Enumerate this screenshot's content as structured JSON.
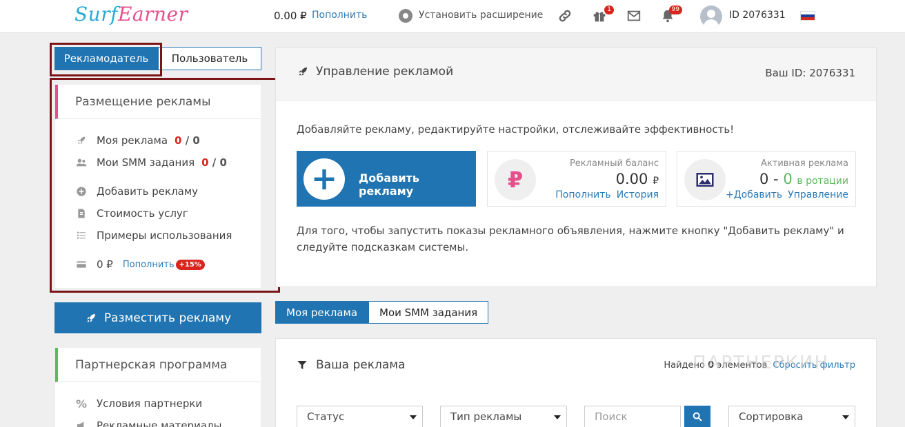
{
  "header": {
    "logo_part1": "Surf",
    "logo_part2": "Earner",
    "balance": "0.00 ₽",
    "topup_label": "Пополнить",
    "extension_label": "Установить расширение",
    "gift_badge": "1",
    "bell_badge": "99",
    "user_id": "ID 2076331"
  },
  "role_tabs": {
    "advertiser": "Рекламодатель",
    "user": "Пользователь"
  },
  "ad_panel": {
    "title": "Размещение рекламы",
    "my_ads_label": "Моя реклама",
    "my_ads_active": "0",
    "my_ads_total": "/ 0",
    "smm_label": "Мои SMM задания",
    "smm_active": "0",
    "smm_total": "/ 0",
    "add_ad_label": "Добавить рекламу",
    "price_label": "Стоимость услуг",
    "examples_label": "Примеры использования",
    "balance": "0 ₽",
    "topup_label": "Пополнить",
    "bonus": "+15%"
  },
  "place_button": "Разместить рекламу",
  "partner_panel": {
    "title": "Партнерская программа",
    "terms_label": "Условия партнерки",
    "materials_label": "Рекламные материалы"
  },
  "main": {
    "title": "Управление рекламой",
    "your_id": "Ваш ID: 2076331",
    "description": "Добавляйте рекламу, редактируйте настройки, отслеживайте эффективность!",
    "add_button": "Добавить рекламу",
    "balance_card": {
      "title": "Рекламный баланс",
      "value": "0.00",
      "currency": "₽",
      "link1": "Пополнить",
      "link2": "История"
    },
    "active_card": {
      "title": "Активная реклама",
      "value_left": "0 -",
      "value_right": "0",
      "rotation": "в ротации",
      "link1": "+Добавить",
      "link2": "Управление"
    },
    "hint": "Для того, чтобы запустить показы рекламного объявления, нажмите кнопку \"Добавить рекламу\" и следуйте подсказкам системы."
  },
  "bottom_tabs": {
    "my_ads": "Моя реклама",
    "smm": "Мои SMM задания"
  },
  "list": {
    "title": "Ваша реклама",
    "found_prefix": "Найдено",
    "found_count": "0",
    "found_suffix": "элементов",
    "reset_filter": "Сбросить фильтр",
    "status_select": "Статус",
    "type_select": "Тип рекламы",
    "search_placeholder": "Поиск",
    "sort_select": "Сортировка"
  },
  "watermark": "ПАРТНЕРКИН",
  "colors": {
    "primary": "#1f74b1",
    "link": "#2c7bb6",
    "accent_pink": "#e74f8c",
    "accent_green": "#5bb85d",
    "badge_red": "#d9251d",
    "highlight_border": "#7b1419"
  }
}
